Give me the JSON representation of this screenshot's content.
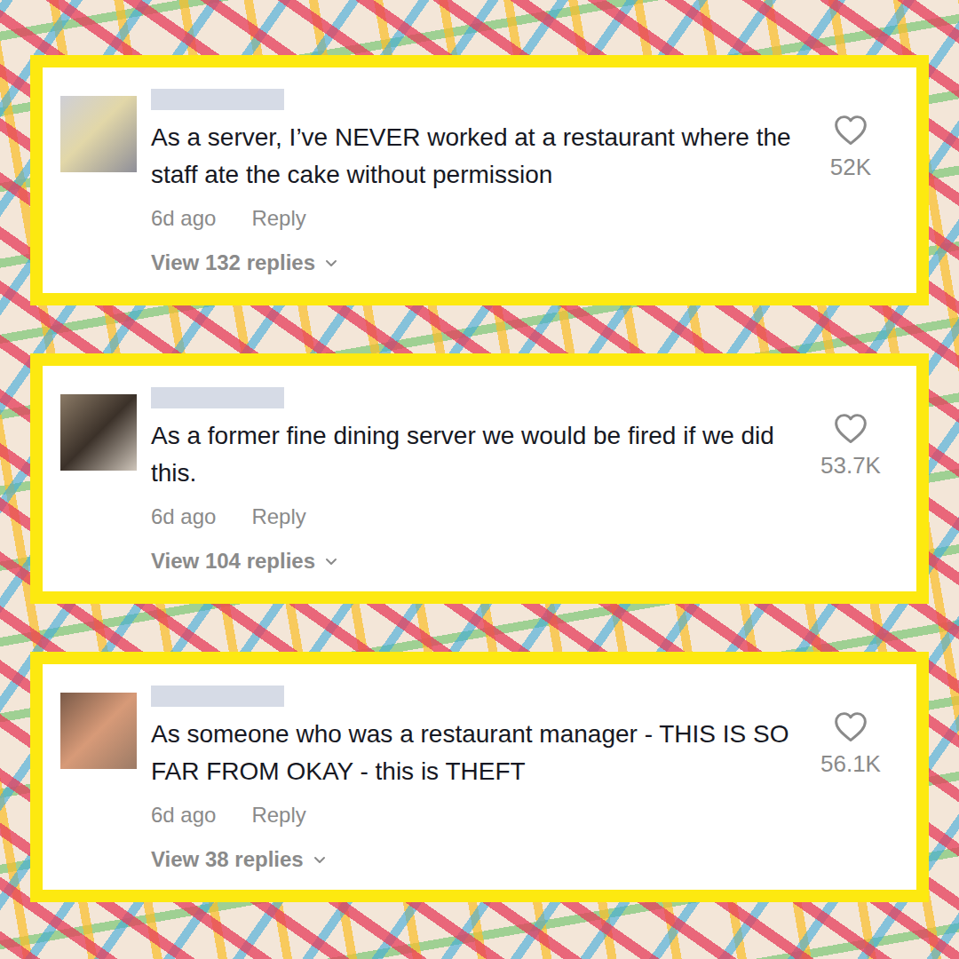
{
  "comments": [
    {
      "text": "As a server, I’ve NEVER worked at a restaurant where the staff ate the cake without permission",
      "time": "6d ago",
      "reply": "Reply",
      "likes": "52K",
      "replies": "View 132 replies",
      "liked": false
    },
    {
      "text": "As a former fine dining server we would be fired if we did this.",
      "time": "6d ago",
      "reply": "Reply",
      "likes": "53.7K",
      "replies": "View 104 replies",
      "liked": false
    },
    {
      "text": "As someone who was a restaurant manager - THIS IS SO FAR FROM OKAY - this is THEFT",
      "time": "6d ago",
      "reply": "Reply",
      "likes": "56.1K",
      "replies": "View 38 replies",
      "liked": false
    }
  ]
}
